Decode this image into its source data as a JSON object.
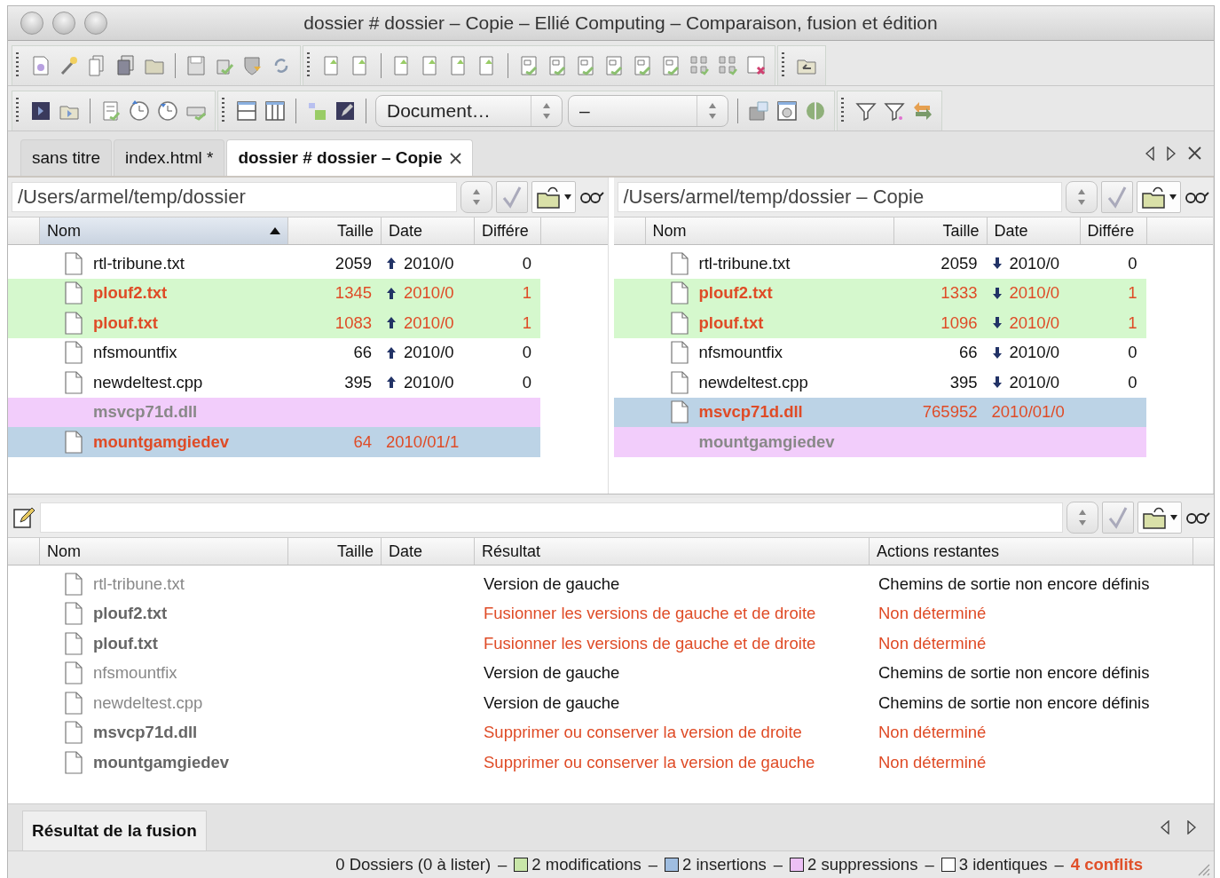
{
  "window": {
    "title": "dossier # dossier – Copie – Ellié Computing – Comparaison, fusion et édition"
  },
  "toolbar": {
    "dropdowns": [
      {
        "value": "Document…"
      },
      {
        "value": "–"
      }
    ]
  },
  "tabs": [
    {
      "label": "sans titre",
      "selected": false,
      "closable": false
    },
    {
      "label": "index.html *",
      "selected": false,
      "closable": false
    },
    {
      "label": "dossier # dossier – Copie",
      "selected": true,
      "closable": true
    }
  ],
  "panes": [
    {
      "path": "/Users/armel/temp/dossier",
      "kind": "source",
      "columns": [
        {
          "label": "Nom",
          "sorted": true
        },
        {
          "label": "Taille",
          "sorted": false
        },
        {
          "label": "Date",
          "sorted": false
        },
        {
          "label": "Différe",
          "sorted": false
        }
      ],
      "rows": [
        {
          "name": "rtl-tribune.txt",
          "size": "2059",
          "date": "2010/0",
          "diff": "0",
          "kind": "same"
        },
        {
          "name": "plouf2.txt",
          "size": "1345",
          "date": "2010/0",
          "diff": "1",
          "kind": "modified"
        },
        {
          "name": "plouf.txt",
          "size": "1083",
          "date": "2010/0",
          "diff": "1",
          "kind": "modified"
        },
        {
          "name": "nfsmountfix",
          "size": "66",
          "date": "2010/0",
          "diff": "0",
          "kind": "same"
        },
        {
          "name": "newdeltest.cpp",
          "size": "395",
          "date": "2010/0",
          "diff": "0",
          "kind": "same"
        },
        {
          "name": "msvcp71d.dll",
          "kind": "deleted"
        },
        {
          "name": "mountgamgiedev",
          "size": "64",
          "date": "2010/01/1",
          "kind": "inserted"
        }
      ]
    },
    {
      "path": "/Users/armel/temp/dossier – Copie",
      "kind": "target",
      "columns": [
        {
          "label": "Nom",
          "sorted": false
        },
        {
          "label": "Taille",
          "sorted": false
        },
        {
          "label": "Date",
          "sorted": false
        },
        {
          "label": "Différe",
          "sorted": false
        }
      ],
      "rows": [
        {
          "name": "rtl-tribune.txt",
          "size": "2059",
          "date": "2010/0",
          "diff": "0",
          "kind": "same"
        },
        {
          "name": "plouf2.txt",
          "size": "1333",
          "date": "2010/0",
          "diff": "1",
          "kind": "modified"
        },
        {
          "name": "plouf.txt",
          "size": "1096",
          "date": "2010/0",
          "diff": "1",
          "kind": "modified"
        },
        {
          "name": "nfsmountfix",
          "size": "66",
          "date": "2010/0",
          "diff": "0",
          "kind": "same"
        },
        {
          "name": "newdeltest.cpp",
          "size": "395",
          "date": "2010/0",
          "diff": "0",
          "kind": "same"
        },
        {
          "name": "msvcp71d.dll",
          "size": "765952",
          "date": "2010/01/0",
          "kind": "inserted"
        },
        {
          "name": "mountgamgiedev",
          "kind": "deleted"
        }
      ]
    }
  ],
  "result": {
    "columns": [
      "Nom",
      "Taille",
      "Date",
      "Résultat",
      "Actions restantes"
    ],
    "rows": [
      {
        "name": "rtl-tribune.txt",
        "result": "Version de gauche",
        "actions": "Chemins de sortie non encore définis",
        "kind": "resolved"
      },
      {
        "name": "plouf2.txt",
        "result": "Fusionner les versions de gauche et de droite",
        "actions": "Non déterminé",
        "kind": "conflict"
      },
      {
        "name": "plouf.txt",
        "result": "Fusionner les versions de gauche et de droite",
        "actions": "Non déterminé",
        "kind": "conflict"
      },
      {
        "name": "nfsmountfix",
        "result": "Version de gauche",
        "actions": "Chemins de sortie non encore définis",
        "kind": "resolved"
      },
      {
        "name": "newdeltest.cpp",
        "result": "Version de gauche",
        "actions": "Chemins de sortie non encore définis",
        "kind": "resolved"
      },
      {
        "name": "msvcp71d.dll",
        "result": "Supprimer ou conserver la version de droite",
        "actions": "Non déterminé",
        "kind": "conflict"
      },
      {
        "name": "mountgamgiedev",
        "result": "Supprimer ou conserver la version de gauche",
        "actions": "Non déterminé",
        "kind": "conflict"
      }
    ]
  },
  "bottom_tabs": [
    {
      "label": "Résultat de la fusion",
      "selected": true
    }
  ],
  "status_bar": {
    "items": [
      {
        "kind": "text",
        "text": "0 Dossiers (0 à lister)"
      },
      {
        "kind": "separator",
        "text": "–"
      },
      {
        "kind": "legend",
        "text": "2 modifications",
        "color": "#c8e6a8"
      },
      {
        "kind": "separator",
        "text": "–"
      },
      {
        "kind": "legend",
        "text": "2 insertions",
        "color": "#9fbde0"
      },
      {
        "kind": "separator",
        "text": "–"
      },
      {
        "kind": "legend",
        "text": "2 suppressions",
        "color": "#ecc0f5"
      },
      {
        "kind": "separator",
        "text": "–"
      },
      {
        "kind": "legend",
        "text": "3 identiques",
        "color": "#ffffff"
      },
      {
        "kind": "separator",
        "text": "–"
      },
      {
        "kind": "alert",
        "text": "4 conflits"
      }
    ]
  }
}
